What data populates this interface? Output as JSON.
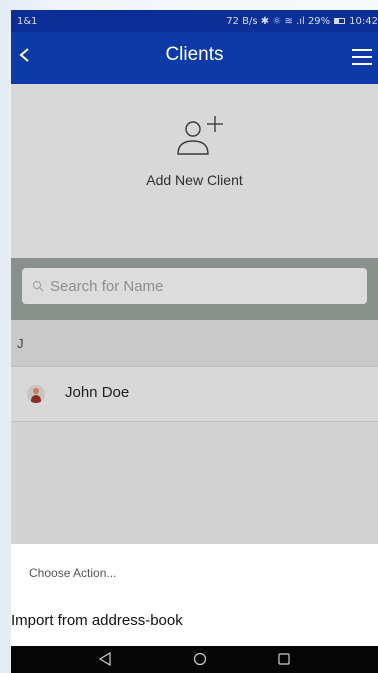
{
  "status_bar": {
    "carrier": "1&1",
    "info": "72 B/s ✱ ☼ ≋ .ıl 29%",
    "time": "10:42"
  },
  "app_bar": {
    "title": "Clients",
    "back_icon": "chevron-left-icon",
    "menu_icon": "hamburger-menu-icon"
  },
  "add_client": {
    "icon": "add-person-icon",
    "label": "Add New Client"
  },
  "search": {
    "placeholder": "Search for Name",
    "value": ""
  },
  "clients": {
    "section_letter": "J",
    "items": [
      {
        "name": "John Doe"
      }
    ]
  },
  "action_sheet": {
    "title": "Choose Action...",
    "items": [
      {
        "label": "Import from address-book"
      }
    ]
  },
  "colors": {
    "app_bar": "#0d3aa6",
    "status_bar": "#0b2f97",
    "dim_background": "#d8d8d8"
  }
}
